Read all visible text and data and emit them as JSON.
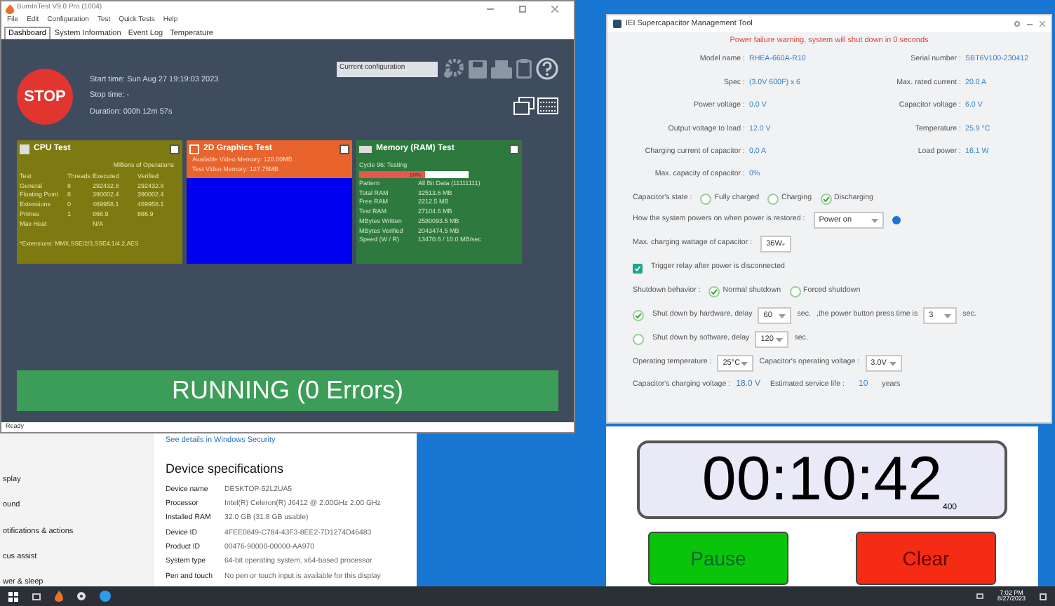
{
  "burnin": {
    "title": "BurnInTest V9.0 Pro (1004)",
    "menu": [
      "File",
      "Edit",
      "Configuration",
      "Test",
      "Quick Tests",
      "Help"
    ],
    "tabs": [
      {
        "label": "Dashboard",
        "selected": true
      },
      {
        "label": "System Information",
        "selected": false
      },
      {
        "label": "Event Log",
        "selected": false
      },
      {
        "label": "Temperature",
        "selected": false
      }
    ],
    "stop_button": "STOP",
    "start_time": "Start time: Sun Aug 27 19:19:03 2023",
    "stop_time": "Stop time: -",
    "duration": "Duration: 000h 12m 57s",
    "config_select": "Current configuration",
    "cpu": {
      "title": "CPU Test",
      "group": "Millions of Operations",
      "columns": [
        "Test",
        "Threads",
        "Executed",
        "Verified"
      ],
      "rows": [
        [
          "General",
          "8",
          "292432.8",
          "292432.8"
        ],
        [
          "Floating Point",
          "8",
          "390002.4",
          "390002.4"
        ],
        [
          "Extensions",
          "0",
          "469958.1",
          "469958.1"
        ],
        [
          "Primes",
          "1",
          "866.9",
          "866.9"
        ],
        [
          "Max Heat",
          "",
          "N/A",
          ""
        ]
      ],
      "note": "*Extensions: MMX,SSE/2/3,SSE4.1/4.2,AES"
    },
    "graphics": {
      "title": "2D Graphics Test",
      "lines": [
        "Available Video Memory: 128.00MB",
        "Test Video Memory: 127.75MB"
      ]
    },
    "memory": {
      "title": "Memory (RAM) Test",
      "cycle": "Cycle 96: Testing",
      "level": 0.6,
      "percent": "60%",
      "rows": [
        [
          "Pattern",
          "All Bit Data (11111111)"
        ],
        [
          "Total RAM",
          "32513.6 MB"
        ],
        [
          "Free RAM",
          "2212.5 MB"
        ],
        [
          "Test RAM",
          "27104.6 MB"
        ],
        [
          "MBytes Written",
          "2580093.5 MB"
        ],
        [
          "MBytes Verified",
          "2043474.5 MB"
        ],
        [
          "Speed (W / R)",
          "13470.6 / 10.0 MB/sec"
        ]
      ]
    },
    "banner": "RUNNING (0 Errors)",
    "status": "Ready"
  },
  "settings": {
    "nav": [
      "splay",
      "ound",
      "otifications & actions",
      "cus assist",
      "wer & sleep"
    ],
    "link": "See details in Windows Security",
    "heading": "Device specifications",
    "specs": [
      [
        "Device name",
        "DESKTOP-52L2UA5"
      ],
      [
        "Processor",
        "Intel(R) Celeron(R) J6412 @ 2.00GHz   2.00 GHz"
      ],
      [
        "Installed RAM",
        "32.0 GB (31.8 GB usable)"
      ],
      [
        "Device ID",
        "4FEE0849-C784-43F3-8EE2-7D1274D46483"
      ],
      [
        "Product ID",
        "00476-90000-00000-AA970"
      ],
      [
        "System type",
        "64-bit operating system, x64-based processor"
      ],
      [
        "Pen and touch",
        "No pen or touch input is available for this display"
      ]
    ]
  },
  "supercap": {
    "title": "IEI Supercapacitor Management Tool",
    "warning": "Power failure warning, system will shut down in 0 seconds",
    "fields": [
      [
        "Model name :",
        "RHEA-660A-R10",
        "Serial number :",
        "SBT6V100-230412"
      ],
      [
        "Spec :",
        "(3.0V 600F) x 6",
        "Max. rated current :",
        "20.0 A"
      ],
      [
        "Power voltage :",
        "0.0 V",
        "Capacitor voltage :",
        "6.0 V"
      ],
      [
        "Output voltage to load :",
        "12.0 V",
        "Temperature :",
        "25.9 °C"
      ],
      [
        "Charging current of capacitor :",
        "0.0 A",
        "Load power :",
        "16.1 W"
      ],
      [
        "Max. capacity of capacitor :",
        "0%"
      ]
    ],
    "state_label": "Capacitor's state :",
    "states": [
      {
        "label": "Fully charged",
        "selected": false
      },
      {
        "label": "Charging",
        "selected": false
      },
      {
        "label": "Discharging",
        "selected": true
      }
    ],
    "power_label": "How the system powers on when power is restored :",
    "power_value": "Power on",
    "wattage_label": "Max. charging wattage of capacitor :",
    "wattage_value": "36W",
    "relay": {
      "label": "Trigger relay after power is disconnected",
      "checked": true
    },
    "behavior_label": "Shutdown behavior :",
    "behaviors": [
      {
        "label": "Normal shutdown",
        "selected": true
      },
      {
        "label": "Forced shutdown",
        "selected": false
      }
    ],
    "hardware": {
      "selected": true,
      "label": "Shut down by hardware, delay",
      "delay": "60",
      "unit": "sec.",
      "press_label": ",the power button press time is",
      "press": "3",
      "press_unit": "sec."
    },
    "software": {
      "selected": false,
      "label": "Shut down by software, delay",
      "delay": "120",
      "unit": "sec."
    },
    "temp_label": "Operating temperature :",
    "temp_value": "25°C",
    "opvolt_label": "Capacitor's operating voltage :",
    "opvolt_value": "3.0V",
    "charge_label": "Capacitor's charging voltage :",
    "charge_value": "18.0 V",
    "life_label": "Estimated service life :",
    "life_value": "10",
    "life_unit": "years"
  },
  "stopwatch": {
    "time": "00:10:42",
    "fraction": "400",
    "buttons": [
      {
        "label": "Pause",
        "kind": "go"
      },
      {
        "label": "Clear",
        "kind": "stop"
      }
    ]
  },
  "taskbar": {
    "time": "7:02 PM",
    "date": "8/27/2023"
  }
}
